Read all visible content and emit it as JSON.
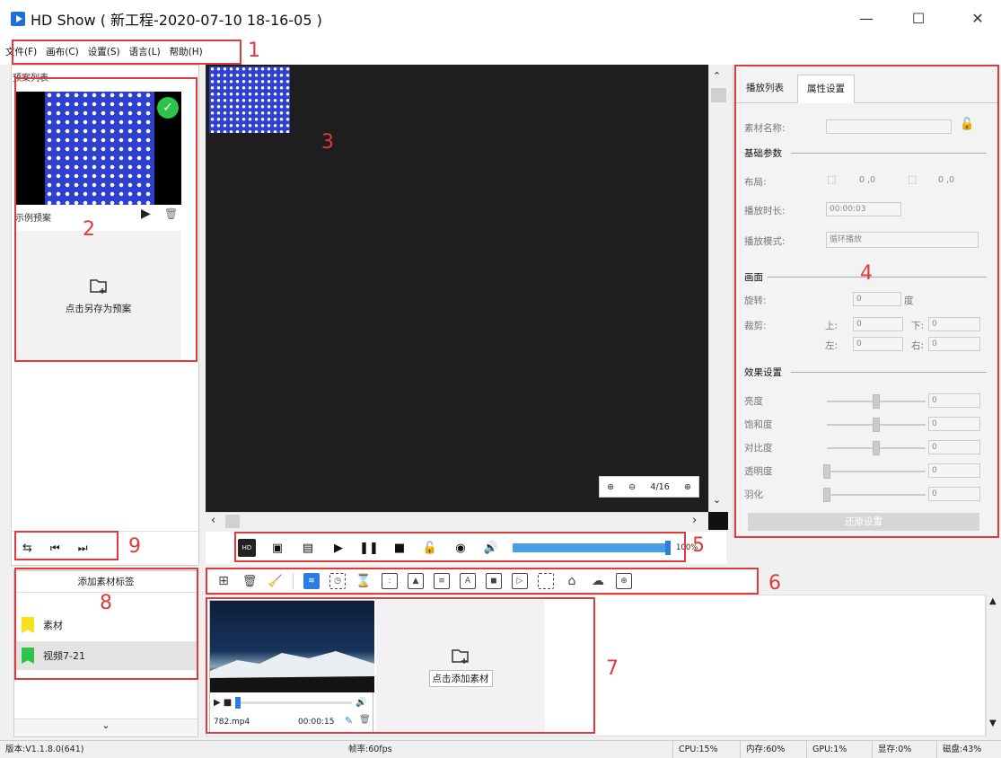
{
  "title": "HD Show ( 新工程-2020-07-10 18-16-05 )",
  "window_controls": {
    "minimize": "—",
    "maximize": "☐",
    "close": "✕"
  },
  "menu": [
    "文件(F)",
    "画布(C)",
    "设置(S)",
    "语言(L)",
    "帮助(H)"
  ],
  "annotations": [
    "1",
    "2",
    "3",
    "4",
    "5",
    "6",
    "7",
    "8",
    "9"
  ],
  "preset_panel": {
    "header": "预案列表",
    "item_label": "示例预案",
    "save_label": "点击另存为预案"
  },
  "canvas": {
    "page_indicator": "4/16"
  },
  "playback": {
    "volume_label": "100%",
    "volume": 1.0
  },
  "right_panel": {
    "tabs": [
      "播放列表",
      "属性设置"
    ],
    "active_tab": 1,
    "material_name_label": "素材名称:",
    "basic_params": "基础参数",
    "layout_label": "布局:",
    "layout_pos": "0 ,0",
    "layout_size": "0 ,0",
    "duration_label": "播放时长:",
    "duration_value": "00:00:03",
    "mode_label": "播放模式:",
    "mode_value": "循环播放",
    "picture": "画面",
    "rotate_label": "旋转:",
    "rotate_value": "0",
    "rotate_unit": "度",
    "crop_label": "裁剪:",
    "crop_top": "上:",
    "crop_bottom": "下:",
    "crop_left": "左:",
    "crop_right": "右:",
    "crop_value": "0",
    "effects": "效果设置",
    "effect_items": [
      {
        "label": "亮度",
        "value": "0",
        "level": 0.5
      },
      {
        "label": "饱和度",
        "value": "0",
        "level": 0.5
      },
      {
        "label": "对比度",
        "value": "0",
        "level": 0.5
      },
      {
        "label": "透明度",
        "value": "0",
        "level": 0.0
      },
      {
        "label": "羽化",
        "value": "0",
        "level": 0.0
      }
    ],
    "restore_label": "还原设置"
  },
  "tag_panel": {
    "add_label": "添加素材标签",
    "tags": [
      {
        "label": "素材",
        "color": "#f5e21b"
      },
      {
        "label": "视频7-21",
        "color": "#2ec44a"
      }
    ]
  },
  "assets": {
    "item": {
      "filename": "782.mp4",
      "duration": "00:00:15"
    },
    "add_label": "点击添加素材"
  },
  "status": {
    "version": "版本:V1.1.8.0(641)",
    "fps": "帧率:60fps",
    "cpu": "CPU:15%",
    "mem": "内存:60%",
    "gpu": "GPU:1%",
    "vram": "显存:0%",
    "disk": "磁盘:43%"
  }
}
